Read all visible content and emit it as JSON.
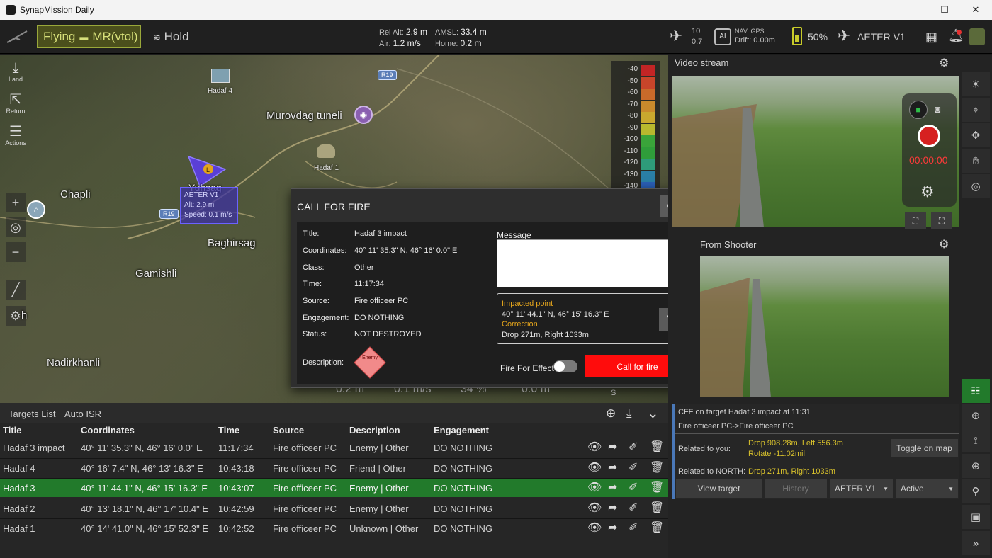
{
  "window": {
    "title": "SynapMission Daily",
    "minimize": "—",
    "maximize": "☐",
    "close": "✕"
  },
  "topbar": {
    "status": "Flying",
    "vehicle_mode": "MR(vtol)",
    "flight_mode": "Hold",
    "rel_alt_label": "Rel Alt:",
    "rel_alt": "2.9 m",
    "air_label": "Air:",
    "air": "1.2 m/s",
    "amsl_label": "AMSL:",
    "amsl": "33.4 m",
    "home_label": "Home:",
    "home": "0.2 m",
    "sat_count": "10",
    "sat_hdop": "0.7",
    "nav_label": "NAV: GPS",
    "drift_label": "Drift:",
    "drift": "0.00m",
    "battery": "50%",
    "vehicle_name": "AETER V1"
  },
  "map": {
    "side_buttons": [
      {
        "label": "Land",
        "icon": "land-icon"
      },
      {
        "label": "Return",
        "icon": "return-icon"
      },
      {
        "label": "Actions",
        "icon": "actions-icon"
      }
    ],
    "labels": {
      "hadaf4": "Hadaf 4",
      "hadaf1": "Hadaf 1",
      "murovdag": "Murovdag tuneli",
      "chapli": "Chapli",
      "baghirsag": "Baghirsag",
      "gamishli": "Gamishli",
      "nadirkhanli": "Nadirkhanli",
      "yuhsag": "Yuhsag",
      "h_letter": "h",
      "road1": "R19",
      "road2": "R19"
    },
    "drone": {
      "name": "AETER V1",
      "alt": "Alt: 2.9 m",
      "speed": "Speed: 0.1 m/s",
      "marker": "L"
    },
    "scale": {
      "labels": [
        "-40",
        "-50",
        "-60",
        "-70",
        "-80",
        "-90",
        "-100",
        "-110",
        "-120",
        "-130",
        "-140"
      ],
      "colors": [
        "#c22525",
        "#c8452a",
        "#c96a2a",
        "#c98a2c",
        "#c9a82e",
        "#b8b82e",
        "#3aa43a",
        "#2f9d3a",
        "#2e9b7a",
        "#2a7fa6",
        "#2a5fb6"
      ]
    },
    "bottom_readouts": [
      "0.2 m",
      "0.1 m/s",
      "34 %",
      "0.0 m"
    ],
    "compass": "S"
  },
  "dialog": {
    "title": "CALL FOR FIRE",
    "close": "Close",
    "fields": [
      {
        "label": "Title:",
        "value": "Hadaf 3 impact"
      },
      {
        "label": "Coordinates:",
        "value": "40° 11' 35.3\" N, 46° 16' 0.0\" E"
      },
      {
        "label": "Class:",
        "value": "Other"
      },
      {
        "label": "Time:",
        "value": "11:17:34"
      },
      {
        "label": "Source:",
        "value": "Fire officeer PC"
      },
      {
        "label": "Engagement:",
        "value": "DO NOTHING"
      },
      {
        "label": "Status:",
        "value": "NOT DESTROYED"
      }
    ],
    "description_label": "Description:",
    "description_symbol": "Enemy",
    "message_label": "Message",
    "message_value": "",
    "impacted_point_label": "Impacted point",
    "impacted_point": "40° 11' 44.1\" N, 46° 15' 16.3\" E",
    "correction_label": "Correction",
    "correction": "Drop 271m, Right 1033m",
    "fire_for_effect_label": "Fire For Effect",
    "fire_for_effect_on": false,
    "call_for_fire_button": "Call for fire"
  },
  "targets": {
    "tabs": [
      "Targets List",
      "Auto ISR"
    ],
    "columns": [
      "Title",
      "Coordinates",
      "Time",
      "Source",
      "Description",
      "Engagement"
    ],
    "rows": [
      {
        "title": "Hadaf 3 impact",
        "coords": "40° 11' 35.3\" N, 46° 16' 0.0\" E",
        "time": "11:17:34",
        "source": "Fire officeer PC",
        "desc": "Enemy | Other",
        "eng": "DO NOTHING"
      },
      {
        "title": "Hadaf 4",
        "coords": "40° 16' 7.4\" N, 46° 13' 16.3\" E",
        "time": "10:43:18",
        "source": "Fire officeer PC",
        "desc": "Friend | Other",
        "eng": "DO NOTHING"
      },
      {
        "title": "Hadaf 3",
        "coords": "40° 11' 44.1\" N, 46° 15' 16.3\" E",
        "time": "10:43:07",
        "source": "Fire officeer PC",
        "desc": "Enemy | Other",
        "eng": "DO NOTHING"
      },
      {
        "title": "Hadaf 2",
        "coords": "40° 13' 18.1\" N, 46° 17' 10.4\" E",
        "time": "10:42:59",
        "source": "Fire officeer PC",
        "desc": "Enemy | Other",
        "eng": "DO NOTHING"
      },
      {
        "title": "Hadaf 1",
        "coords": "40° 14' 41.0\" N, 46° 15' 52.3\" E",
        "time": "10:42:52",
        "source": "Fire officeer PC",
        "desc": "Unknown | Other",
        "eng": "DO NOTHING"
      }
    ],
    "selected_index": 2
  },
  "right": {
    "video_title": "Video stream",
    "shooter_title": "From Shooter",
    "rec_time": "00:00:00",
    "cff_title": "CFF on target Hadaf 3 impact at 11:31",
    "cff_route": "Fire officeer PC->Fire officeer PC",
    "related_you_label": "Related to you:",
    "related_you_1": "Drop 908.28m, Left 556.3m",
    "related_you_2": "Rotate -11.02mil",
    "toggle_on_map": "Toggle on map",
    "related_north_label": "Related to NORTH:",
    "related_north": "Drop 271m, Right 1033m",
    "view_target": "View target",
    "history": "History",
    "vehicle_select": "AETER V1",
    "status_select": "Active"
  }
}
